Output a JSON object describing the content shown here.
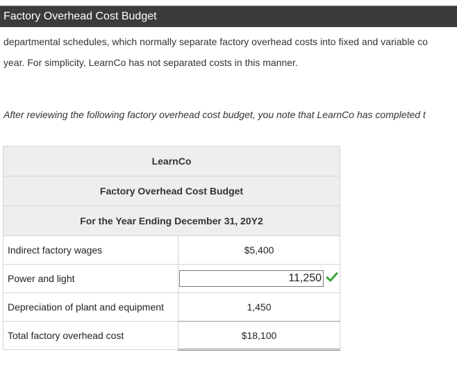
{
  "header": {
    "title": "Factory Overhead Cost Budget"
  },
  "intro": {
    "line1": "departmental schedules, which normally separate factory overhead costs into fixed and variable co",
    "line2": "year. For simplicity, LearnCo has not separated costs in this manner."
  },
  "instruction": "After reviewing the following factory overhead cost budget, you note that LearnCo has completed t",
  "budget": {
    "company": "LearnCo",
    "title": "Factory Overhead Cost Budget",
    "period": "For the Year Ending December 31, 20Y2",
    "rows": [
      {
        "label": "Indirect factory wages",
        "amount": "$5,400"
      },
      {
        "label": "Power and light",
        "amount": "11,250",
        "status": "correct"
      },
      {
        "label": "Depreciation of plant and equipment",
        "amount": "1,450"
      },
      {
        "label": "Total factory overhead cost",
        "amount": "$18,100"
      }
    ]
  },
  "colors": {
    "title_bar": "#3b3b3b",
    "header_bg": "#eeeeee",
    "check": "#3aa635"
  },
  "icons": {
    "status": "check-icon"
  }
}
